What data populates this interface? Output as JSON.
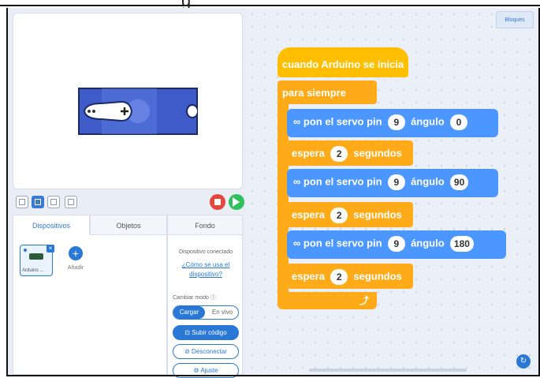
{
  "header": {
    "partial_glyph": "g"
  },
  "workspace": {
    "tab_label": "Bloques"
  },
  "view_toolbar": {
    "stop_label": "stop",
    "go_label": "go"
  },
  "tabs": [
    {
      "label": "Dispositivos",
      "active": true
    },
    {
      "label": "Objetos",
      "active": false
    },
    {
      "label": "Fondo",
      "active": false
    }
  ],
  "devices": {
    "device_label": "Arduino ...",
    "add_label": "Añadir"
  },
  "side_panel": {
    "connected_text": "Dispositivo conectado",
    "help_link": "¿Cómo se usa el dispositivo?",
    "mode_label": "Cambiar modo",
    "mode_on": "Cargar",
    "mode_off": "En vivo",
    "upload_button": "Subir código",
    "disconnect_button": "Desconectar",
    "settings_button": "Ajuste"
  },
  "script": {
    "hat": "cuando Arduino se inicia",
    "loop": "para siempre",
    "servo_text": "pon el servo pin",
    "angle_text": "ángulo",
    "wait_text": "espera",
    "seconds_text": "segundos",
    "steps": [
      {
        "pin": "9",
        "angle": "0",
        "wait": "2"
      },
      {
        "pin": "9",
        "angle": "90",
        "wait": "2"
      },
      {
        "pin": "9",
        "angle": "180",
        "wait": "2"
      }
    ]
  },
  "colors": {
    "accent": "#2a78d6",
    "event_block": "#ffbf00",
    "control_block": "#ffab19",
    "servo_block": "#4c97ff",
    "stop": "#e2483d",
    "go": "#2fbf5f"
  }
}
